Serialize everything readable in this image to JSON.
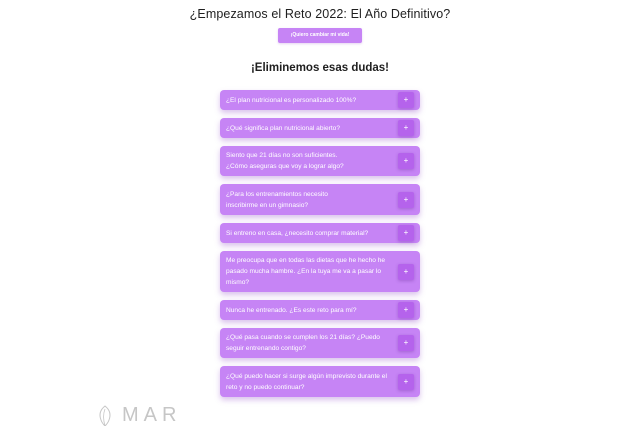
{
  "header": {
    "title": "¿Empezamos el Reto 2022: El Año Definitivo?",
    "cta_label": "¡Quiero cambiar mi vida!"
  },
  "faq": {
    "heading": "¡Eliminemos esas dudas!",
    "toggle_symbol": "+",
    "items": [
      {
        "question": "¿El plan nutricional es personalizado 100%?"
      },
      {
        "question": "¿Qué significa plan nutricional abierto?"
      },
      {
        "question": "Siento que 21 días no son suficientes.\n¿Cómo aseguras que voy a lograr algo?"
      },
      {
        "question": "¿Para los entrenamientos necesito\ninscribirme en un gimnasio?"
      },
      {
        "question": "Si entreno en casa, ¿necesito comprar material?"
      },
      {
        "question": "Me preocupa que en todas las dietas que he hecho he\npasado mucha hambre. ¿En la tuya me va a pasar lo\nmismo?"
      },
      {
        "question": "Nunca he entrenado. ¿Es este reto para mí?"
      },
      {
        "question": "¿Qué pasa cuando se cumplen los 21 días? ¿Puedo\nseguir entrenando contigo?"
      },
      {
        "question": "¿Qué puedo hacer si surge algún imprevisto durante el\nreto y no puedo continuar?"
      }
    ]
  },
  "footer": {
    "logo_text": "MAR"
  },
  "colors": {
    "accent": "#c684f5",
    "toggle": "#b563ec"
  }
}
